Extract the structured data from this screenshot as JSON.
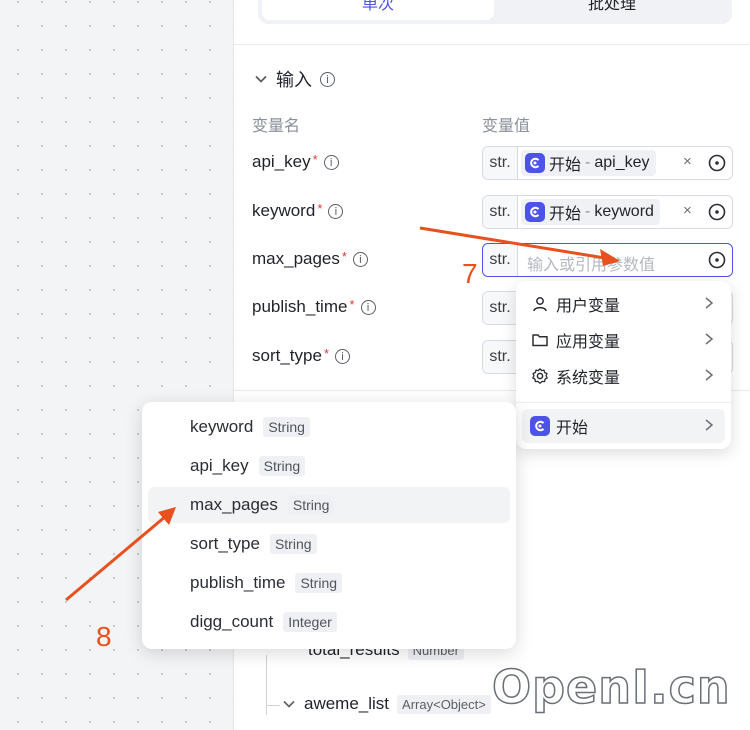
{
  "tabs": {
    "single": "单次",
    "batch": "批处理"
  },
  "section": {
    "title": "输入",
    "col_name": "变量名",
    "col_value": "变量值"
  },
  "inputs": [
    {
      "name": "api_key",
      "type": "str.",
      "ref_node": "开始",
      "ref_sep": "-",
      "ref_var": "api_key"
    },
    {
      "name": "keyword",
      "type": "str.",
      "ref_node": "开始",
      "ref_sep": "-",
      "ref_var": "keyword"
    },
    {
      "name": "max_pages",
      "type": "str.",
      "placeholder": "输入或引用参数值"
    },
    {
      "name": "publish_time",
      "type": "str."
    },
    {
      "name": "sort_type",
      "type": "str."
    }
  ],
  "required_mark": "*",
  "clear_glyph": "×",
  "source_menu": {
    "items": [
      {
        "label": "用户变量",
        "icon": "user-icon"
      },
      {
        "label": "应用变量",
        "icon": "folder-icon"
      },
      {
        "label": "系统变量",
        "icon": "gear-icon"
      },
      {
        "label": "开始",
        "icon": "start-node-icon"
      }
    ]
  },
  "var_dropdown": {
    "items": [
      {
        "name": "keyword",
        "type": "String"
      },
      {
        "name": "api_key",
        "type": "String"
      },
      {
        "name": "max_pages",
        "type": "String"
      },
      {
        "name": "sort_type",
        "type": "String"
      },
      {
        "name": "publish_time",
        "type": "String"
      },
      {
        "name": "digg_count",
        "type": "Integer"
      }
    ],
    "highlighted": "max_pages"
  },
  "output_tree": [
    {
      "name": "total_results",
      "type": "Number"
    },
    {
      "name": "aweme_list",
      "type": "Array<Object>"
    }
  ],
  "annotations": {
    "step7": "7",
    "step8": "8"
  },
  "watermark": "OpenI.cn",
  "colors": {
    "accent": "#4d53e8",
    "annotation": "#e8501e",
    "required": "#e03b3b"
  }
}
